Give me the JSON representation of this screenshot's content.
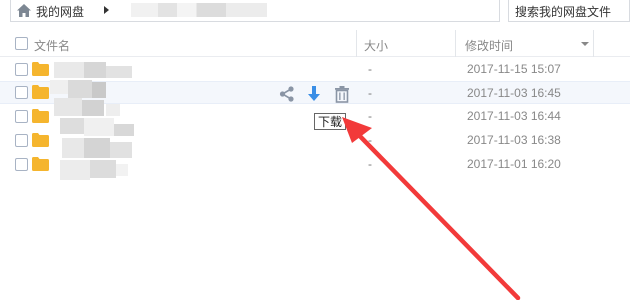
{
  "breadcrumb": {
    "root_label": "我的网盘"
  },
  "search": {
    "label": "搜索我的网盘文件"
  },
  "table": {
    "headers": {
      "name": "文件名",
      "size": "大小",
      "modified": "修改时间"
    },
    "rows": [
      {
        "size": "-",
        "modified": "2017-11-15 15:07"
      },
      {
        "size": "-",
        "modified": "2017-11-03 16:45"
      },
      {
        "size": "-",
        "modified": "2017-11-03 16:44"
      },
      {
        "size": "-",
        "modified": "2017-11-03 16:38"
      },
      {
        "size": "-",
        "modified": "2017-11-01 16:20"
      }
    ]
  },
  "tooltip": {
    "label": "下载"
  },
  "icons": {
    "home": "home-icon",
    "share": "share-icon",
    "download": "download-icon",
    "delete": "trash-icon",
    "folder": "folder-icon"
  },
  "colors": {
    "accent": "#3a8ee6",
    "folder": "#f5b52e",
    "arrow": "#f23a3a"
  }
}
